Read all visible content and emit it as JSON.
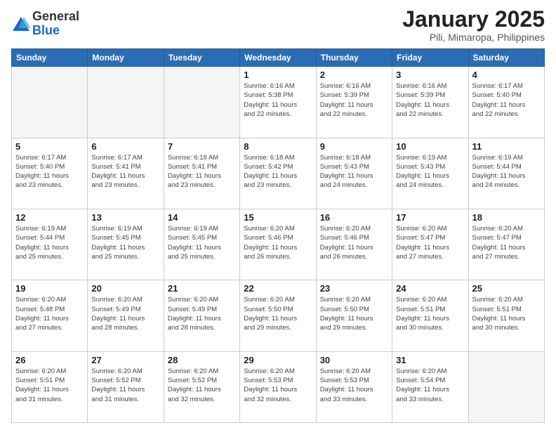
{
  "logo": {
    "general": "General",
    "blue": "Blue"
  },
  "title": "January 2025",
  "subtitle": "Pili, Mimaropa, Philippines",
  "days_of_week": [
    "Sunday",
    "Monday",
    "Tuesday",
    "Wednesday",
    "Thursday",
    "Friday",
    "Saturday"
  ],
  "weeks": [
    [
      {
        "day": "",
        "info": ""
      },
      {
        "day": "",
        "info": ""
      },
      {
        "day": "",
        "info": ""
      },
      {
        "day": "1",
        "info": "Sunrise: 6:16 AM\nSunset: 5:38 PM\nDaylight: 11 hours\nand 22 minutes."
      },
      {
        "day": "2",
        "info": "Sunrise: 6:16 AM\nSunset: 5:39 PM\nDaylight: 11 hours\nand 22 minutes."
      },
      {
        "day": "3",
        "info": "Sunrise: 6:16 AM\nSunset: 5:39 PM\nDaylight: 11 hours\nand 22 minutes."
      },
      {
        "day": "4",
        "info": "Sunrise: 6:17 AM\nSunset: 5:40 PM\nDaylight: 11 hours\nand 22 minutes."
      }
    ],
    [
      {
        "day": "5",
        "info": "Sunrise: 6:17 AM\nSunset: 5:40 PM\nDaylight: 11 hours\nand 23 minutes."
      },
      {
        "day": "6",
        "info": "Sunrise: 6:17 AM\nSunset: 5:41 PM\nDaylight: 11 hours\nand 23 minutes."
      },
      {
        "day": "7",
        "info": "Sunrise: 6:18 AM\nSunset: 5:41 PM\nDaylight: 11 hours\nand 23 minutes."
      },
      {
        "day": "8",
        "info": "Sunrise: 6:18 AM\nSunset: 5:42 PM\nDaylight: 11 hours\nand 23 minutes."
      },
      {
        "day": "9",
        "info": "Sunrise: 6:18 AM\nSunset: 5:43 PM\nDaylight: 11 hours\nand 24 minutes."
      },
      {
        "day": "10",
        "info": "Sunrise: 6:19 AM\nSunset: 5:43 PM\nDaylight: 11 hours\nand 24 minutes."
      },
      {
        "day": "11",
        "info": "Sunrise: 6:19 AM\nSunset: 5:44 PM\nDaylight: 11 hours\nand 24 minutes."
      }
    ],
    [
      {
        "day": "12",
        "info": "Sunrise: 6:19 AM\nSunset: 5:44 PM\nDaylight: 11 hours\nand 25 minutes."
      },
      {
        "day": "13",
        "info": "Sunrise: 6:19 AM\nSunset: 5:45 PM\nDaylight: 11 hours\nand 25 minutes."
      },
      {
        "day": "14",
        "info": "Sunrise: 6:19 AM\nSunset: 5:45 PM\nDaylight: 11 hours\nand 25 minutes."
      },
      {
        "day": "15",
        "info": "Sunrise: 6:20 AM\nSunset: 5:46 PM\nDaylight: 11 hours\nand 26 minutes."
      },
      {
        "day": "16",
        "info": "Sunrise: 6:20 AM\nSunset: 5:46 PM\nDaylight: 11 hours\nand 26 minutes."
      },
      {
        "day": "17",
        "info": "Sunrise: 6:20 AM\nSunset: 5:47 PM\nDaylight: 11 hours\nand 27 minutes."
      },
      {
        "day": "18",
        "info": "Sunrise: 6:20 AM\nSunset: 5:47 PM\nDaylight: 11 hours\nand 27 minutes."
      }
    ],
    [
      {
        "day": "19",
        "info": "Sunrise: 6:20 AM\nSunset: 5:48 PM\nDaylight: 11 hours\nand 27 minutes."
      },
      {
        "day": "20",
        "info": "Sunrise: 6:20 AM\nSunset: 5:49 PM\nDaylight: 11 hours\nand 28 minutes."
      },
      {
        "day": "21",
        "info": "Sunrise: 6:20 AM\nSunset: 5:49 PM\nDaylight: 11 hours\nand 28 minutes."
      },
      {
        "day": "22",
        "info": "Sunrise: 6:20 AM\nSunset: 5:50 PM\nDaylight: 11 hours\nand 29 minutes."
      },
      {
        "day": "23",
        "info": "Sunrise: 6:20 AM\nSunset: 5:50 PM\nDaylight: 11 hours\nand 29 minutes."
      },
      {
        "day": "24",
        "info": "Sunrise: 6:20 AM\nSunset: 5:51 PM\nDaylight: 11 hours\nand 30 minutes."
      },
      {
        "day": "25",
        "info": "Sunrise: 6:20 AM\nSunset: 5:51 PM\nDaylight: 11 hours\nand 30 minutes."
      }
    ],
    [
      {
        "day": "26",
        "info": "Sunrise: 6:20 AM\nSunset: 5:51 PM\nDaylight: 11 hours\nand 31 minutes."
      },
      {
        "day": "27",
        "info": "Sunrise: 6:20 AM\nSunset: 5:52 PM\nDaylight: 11 hours\nand 31 minutes."
      },
      {
        "day": "28",
        "info": "Sunrise: 6:20 AM\nSunset: 5:52 PM\nDaylight: 11 hours\nand 32 minutes."
      },
      {
        "day": "29",
        "info": "Sunrise: 6:20 AM\nSunset: 5:53 PM\nDaylight: 11 hours\nand 32 minutes."
      },
      {
        "day": "30",
        "info": "Sunrise: 6:20 AM\nSunset: 5:53 PM\nDaylight: 11 hours\nand 33 minutes."
      },
      {
        "day": "31",
        "info": "Sunrise: 6:20 AM\nSunset: 5:54 PM\nDaylight: 11 hours\nand 33 minutes."
      },
      {
        "day": "",
        "info": ""
      }
    ]
  ]
}
